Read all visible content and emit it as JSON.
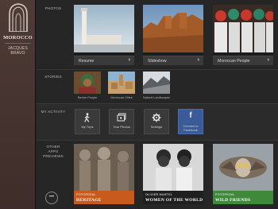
{
  "app": {
    "title": "MOROCCO",
    "author_line1": "JACQUES",
    "author_line2": "BRAVO"
  },
  "sections": {
    "photos": "PHOTOS",
    "stories": "STORIES",
    "activity": "MY ACTIVITY",
    "previews_line1": "OTHER",
    "previews_line2": "APPS",
    "previews_line3": "PREVIEWS"
  },
  "photos": [
    {
      "label": "Resume",
      "icon": "chevron-right-icon"
    },
    {
      "label": "Slideshow",
      "icon": "chevron-right-icon"
    },
    {
      "label": "Moroccan People",
      "icon": "chevron-right-icon"
    }
  ],
  "stories": [
    {
      "label": "Berber People"
    },
    {
      "label": "Moroccan Cities"
    },
    {
      "label": "Natural Landscapes"
    }
  ],
  "activity": [
    {
      "label": "My Trips",
      "icon": "walking-person-icon"
    },
    {
      "label": "Your Photos",
      "icon": "photos-icon"
    },
    {
      "label": "Settings",
      "icon": "gear-icon"
    },
    {
      "label_line1": "Connect to",
      "label_line2": "Facebook",
      "icon": "facebook-icon",
      "color": "#3a5b98"
    }
  ],
  "previews": [
    {
      "publisher": "POTOPEDIA",
      "title": "HERITAGE",
      "color": "#c85a1e"
    },
    {
      "publisher": "OLIVIER MARTEL",
      "title": "WOMEN OF THE WORLD",
      "color": "#1f1f1f"
    },
    {
      "publisher": "POTOPEDIA",
      "title": "WILD FRIENDS",
      "color": "#3e8a3a"
    }
  ],
  "more_button": "•••"
}
